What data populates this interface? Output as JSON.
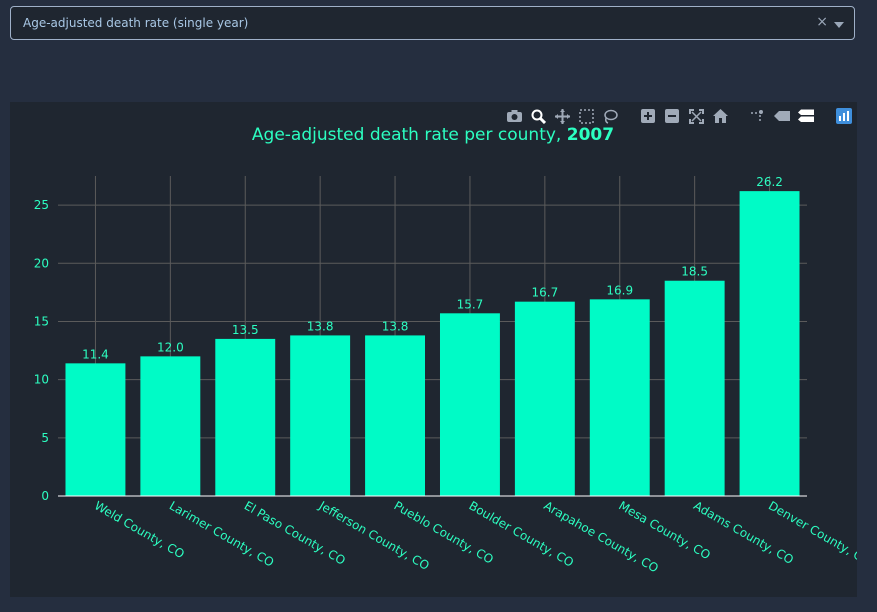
{
  "dropdown": {
    "value": "Age-adjusted death rate (single year)",
    "clear_symbol": "×"
  },
  "modebar": {
    "buttons": [
      "camera-icon",
      "zoom-icon",
      "pan-icon",
      "box-select-icon",
      "lasso-icon",
      "zoom-in-icon",
      "zoom-out-icon",
      "autoscale-icon",
      "reset-axes-icon",
      "spike-lines-icon",
      "hover-closest-icon",
      "hover-compare-icon",
      "plotly-logo-icon"
    ]
  },
  "colors": {
    "bar": "#00fbc6",
    "text": "#2cfec1",
    "grid": "#5b5b5b",
    "panel": "#1f2630",
    "page": "#252e3f"
  },
  "chart_data": {
    "type": "bar",
    "title_prefix": "Age-adjusted death rate per county, ",
    "title_year": "2007",
    "categories": [
      "Weld County,  CO",
      "Larimer County,  CO",
      "El Paso County,  CO",
      "Jefferson County,  CO",
      "Pueblo County,  CO",
      "Boulder County,  CO",
      "Arapahoe County,  CO",
      "Mesa County,  CO",
      "Adams County,  CO",
      "Denver County,  CO"
    ],
    "values": [
      11.4,
      12.0,
      13.5,
      13.8,
      13.8,
      15.7,
      16.7,
      16.9,
      18.5,
      26.2
    ],
    "labels": [
      "11.4",
      "12.0",
      "13.5",
      "13.8",
      "13.8",
      "15.7",
      "16.7",
      "16.9",
      "18.5",
      "26.2"
    ],
    "yticks": [
      0,
      5,
      10,
      15,
      20,
      25
    ],
    "ylim": [
      0,
      27.5
    ],
    "grid": true
  }
}
